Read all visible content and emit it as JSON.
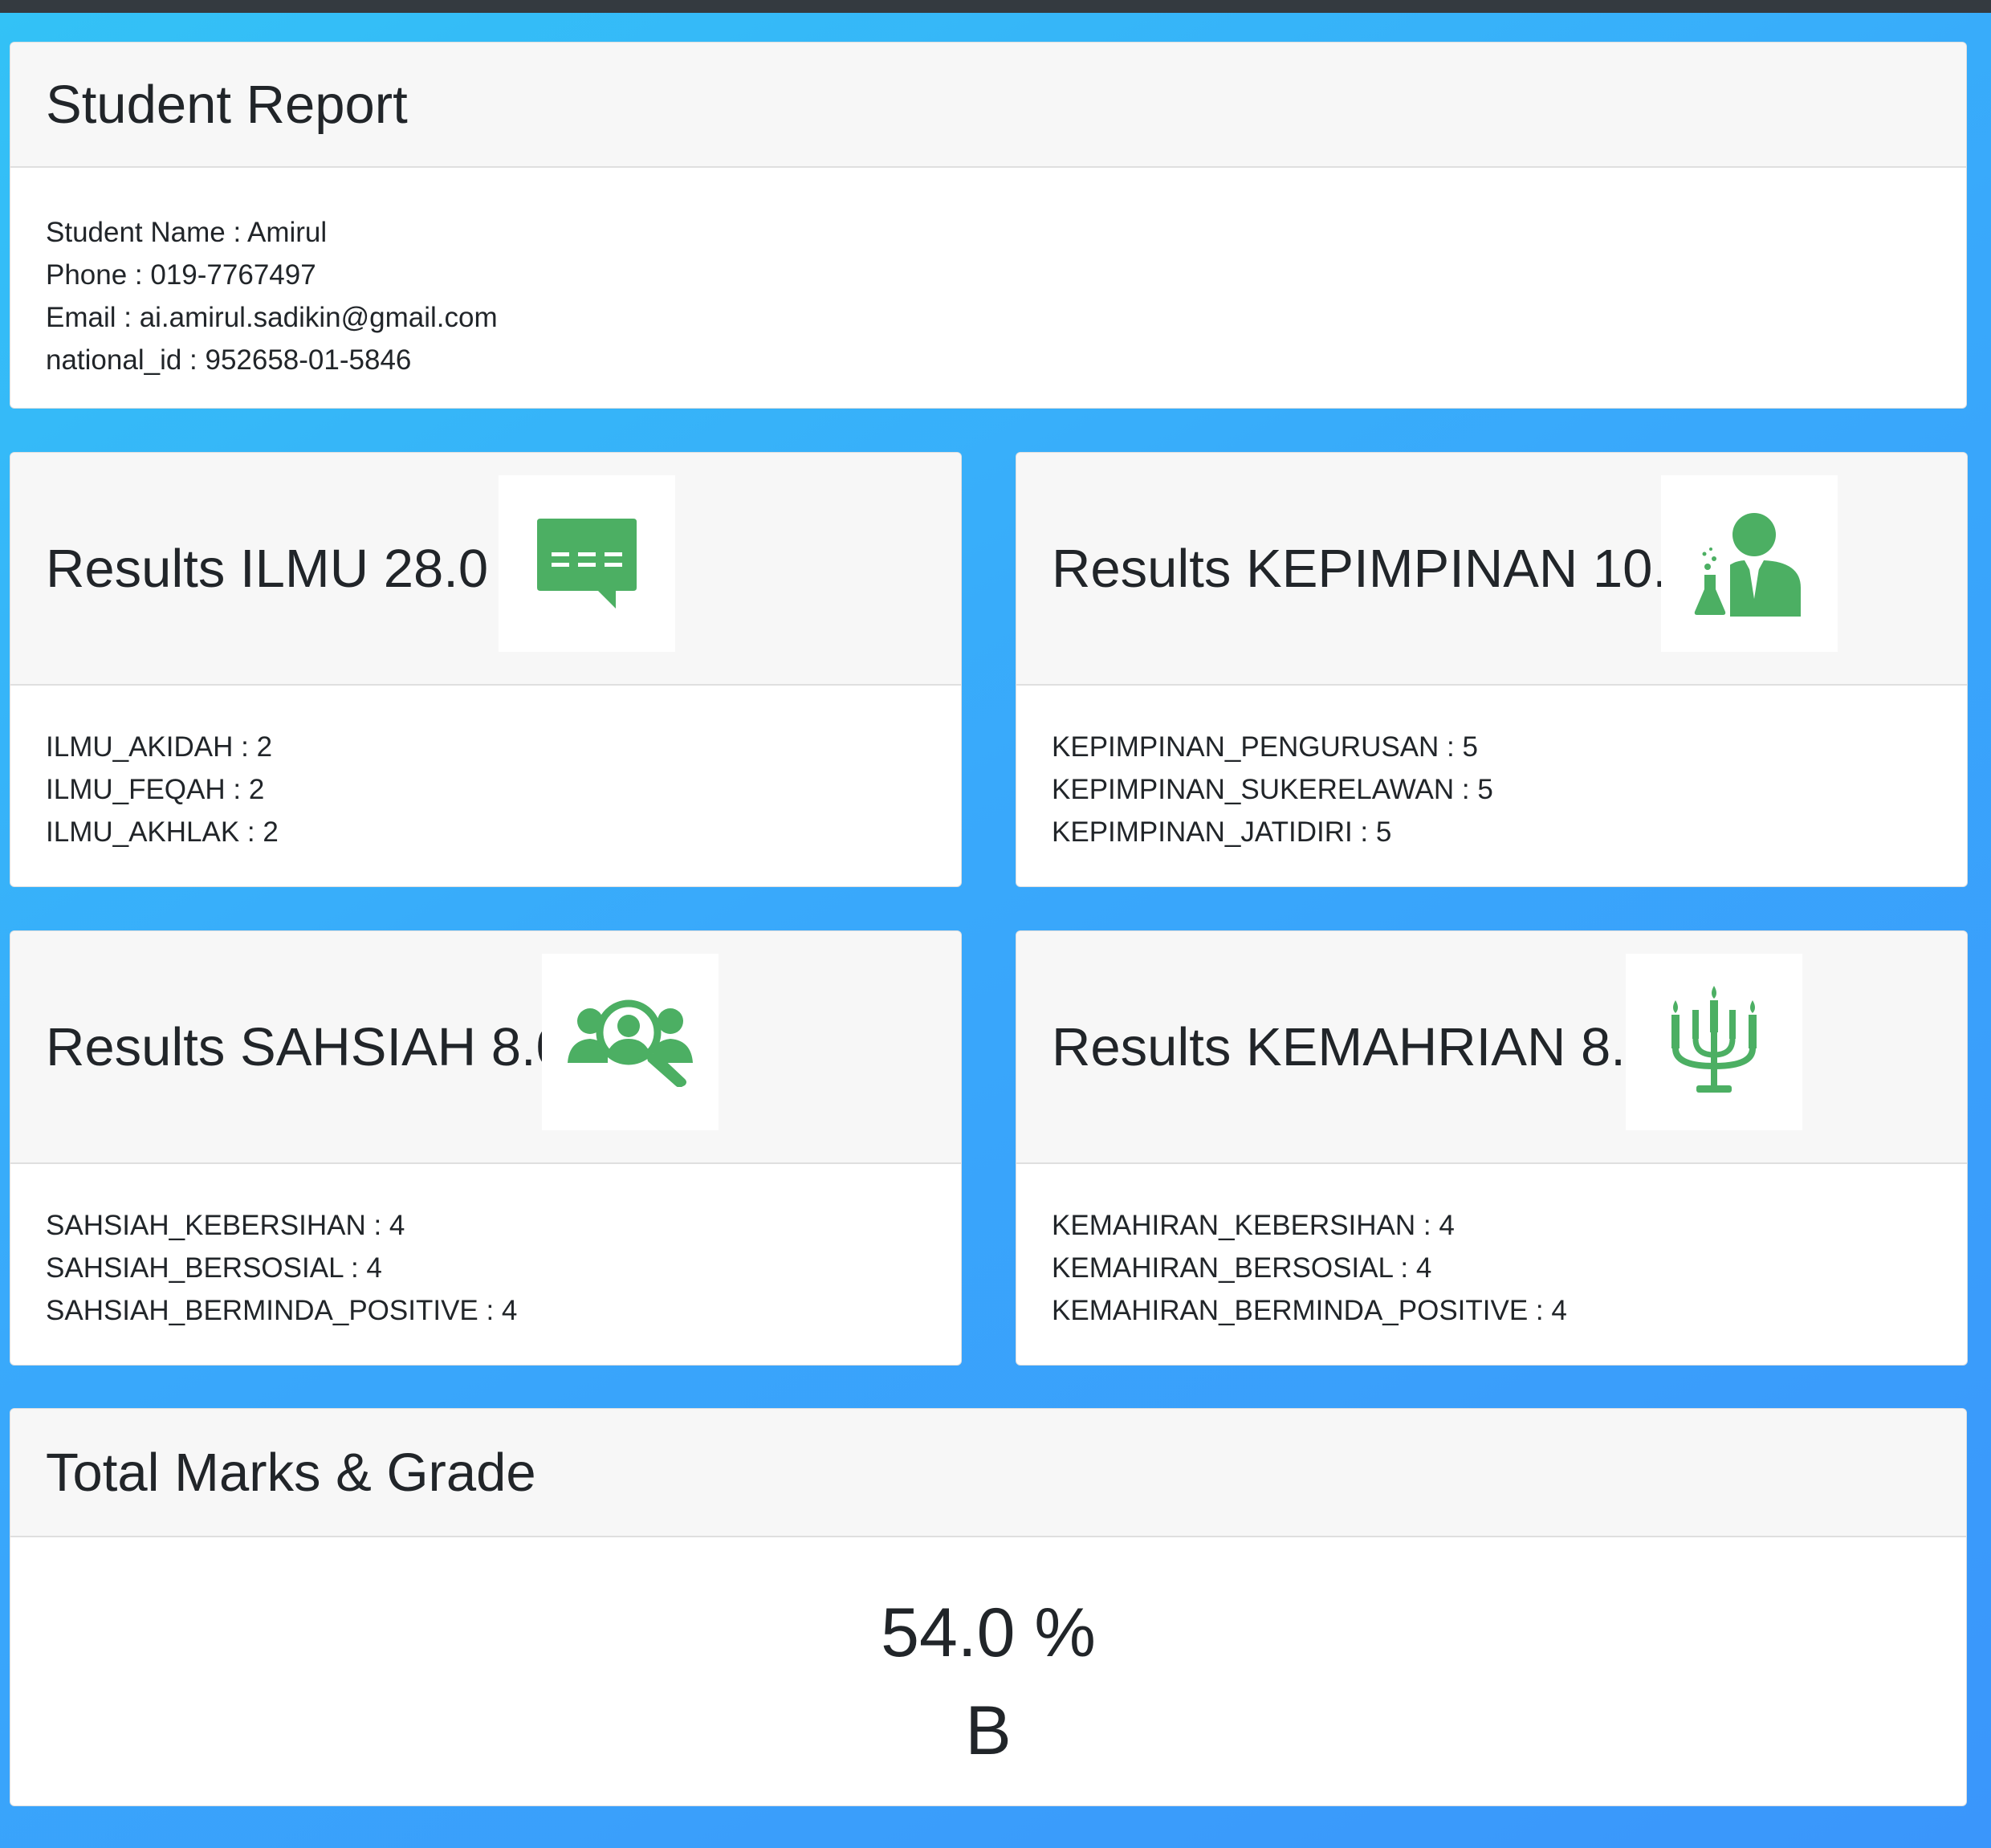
{
  "report": {
    "title": "Student Report",
    "lines": [
      "Student Name : Amirul",
      "Phone : 019-7767497",
      "Email : ai.amirul.sadikin@gmail.com",
      "national_id : 952658-01-5846"
    ]
  },
  "results": [
    {
      "title": "Results ILMU 28.0 %",
      "icon": "chat-bubble-icon",
      "items": [
        "ILMU_AKIDAH : 2",
        "ILMU_FEQAH : 2",
        "ILMU_AKHLAK : 2"
      ]
    },
    {
      "title": "Results KEPIMPINAN 10.0 %",
      "icon": "scientist-icon",
      "items": [
        "KEPIMPINAN_PENGURUSAN : 5",
        "KEPIMPINAN_SUKERELAWAN : 5",
        "KEPIMPINAN_JATIDIRI : 5"
      ]
    },
    {
      "title": "Results SAHSIAH 8.0 %",
      "icon": "people-search-icon",
      "items": [
        "SAHSIAH_KEBERSIHAN : 4",
        "SAHSIAH_BERSOSIAL : 4",
        "SAHSIAH_BERMINDA_POSITIVE : 4"
      ]
    },
    {
      "title": "Results KEMAHRIAN 8.0 %",
      "icon": "candelabra-icon",
      "items": [
        "KEMAHIRAN_KEBERSIHAN : 4",
        "KEMAHIRAN_BERSOSIAL : 4",
        "KEMAHIRAN_BERMINDA_POSITIVE : 4"
      ]
    }
  ],
  "total": {
    "title": "Total Marks & Grade",
    "percent": "54.0 %",
    "grade": "B"
  },
  "colors": {
    "icon_green": "#4caf63",
    "gradient_top": "#33c2f6",
    "gradient_bottom": "#3a96fb",
    "topbar": "#343a40"
  }
}
